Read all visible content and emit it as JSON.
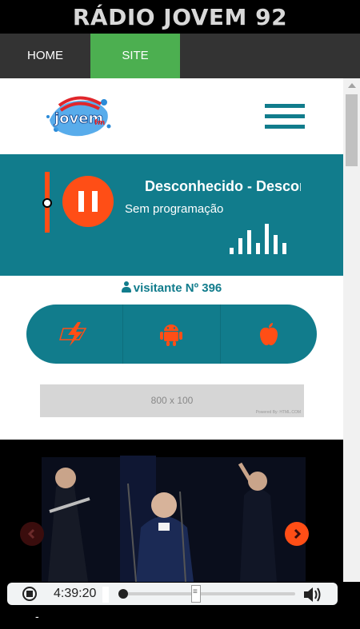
{
  "app": {
    "title": "RÁDIO JOVEM 92"
  },
  "tabs": [
    {
      "label": "HOME"
    },
    {
      "label": "SITE"
    }
  ],
  "colors": {
    "teal": "#117c8c",
    "orange": "#ff4e16",
    "green": "#4caf50",
    "tab_bar": "#333333"
  },
  "header": {
    "logo_text": "jovem",
    "logo_suffix": "fm",
    "menu_icon": "hamburger-icon"
  },
  "player": {
    "state_icon": "pause-icon",
    "song": "Desconhecido - Desconhecido",
    "program": "Sem programação",
    "equalizer_icon": "equalizer-icon"
  },
  "visitor": {
    "label": "visitante Nº 396",
    "icon": "user-icon"
  },
  "apps": {
    "icons": [
      "flash-icon",
      "android-icon",
      "apple-icon"
    ]
  },
  "banner": {
    "size_label": "800 x 100",
    "credit": "Powered By: HTML.COM"
  },
  "slider": {
    "prev_icon": "chevron-left-icon",
    "next_icon": "chevron-right-icon"
  },
  "audio": {
    "time": "4:39:20",
    "stop_icon": "stop-icon",
    "volume_icon": "volume-icon"
  },
  "footer": {
    "text": "-"
  }
}
